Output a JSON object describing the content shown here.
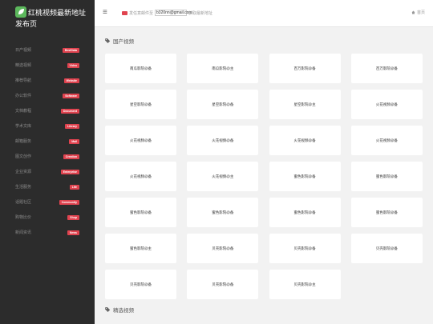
{
  "brand": {
    "title": "红桃视频最新地址发布页"
  },
  "sidebar": {
    "items": [
      {
        "label": "日产视频",
        "badge": "BestData"
      },
      {
        "label": "精选视频",
        "badge": "Video"
      },
      {
        "label": "推荐导航",
        "badge": "Website"
      },
      {
        "label": "办公软件",
        "badge": "Software"
      },
      {
        "label": "文档教程",
        "badge": "Document"
      },
      {
        "label": "学术文库",
        "badge": "Library"
      },
      {
        "label": "邮箱服务",
        "badge": "Mail"
      },
      {
        "label": "图文创作",
        "badge": "Creation"
      },
      {
        "label": "企业资源",
        "badge": "Enterprise"
      },
      {
        "label": "生活服务",
        "badge": "Life"
      },
      {
        "label": "话题社区",
        "badge": "Community"
      },
      {
        "label": "购物比价",
        "badge": "Shop"
      },
      {
        "label": "新闻资讯",
        "badge": "News"
      }
    ]
  },
  "topbar": {
    "menu_icon": "≡",
    "notice_prefix": "发任意邮件至",
    "email": "b320nn@gmail.com",
    "notice_suffix": "获取最新地址",
    "home_label": "首页"
  },
  "sections": {
    "domestic": {
      "title": "国产视频",
      "cards": [
        "南瓜影院@备",
        "南瓜影院@主",
        "百万影院@备",
        "百万影院@备",
        "星空影院@备",
        "星空影院@备",
        "星空影院@主",
        "火花视频@备",
        "火花视频@备",
        "火花视频@备",
        "火花视频@备",
        "火花视频@备",
        "火花视频@备",
        "火花视频@主",
        "蜜色影院@备",
        "蜜色影院@备",
        "蜜色影院@备",
        "蜜色影院@备",
        "蜜色影院@备",
        "蜜色影院@备",
        "蜜色影院@主",
        "贝壳影院@备",
        "贝壳影院@备",
        "贝壳影院@备",
        "贝壳影院@备",
        "贝壳影院@备",
        "贝壳影院@主"
      ]
    },
    "featured": {
      "title": "精选视频"
    }
  },
  "colors": {
    "sidebar_bg": "#2c2c2c",
    "badge": "#e0434f",
    "logo": "#5cb85c"
  }
}
